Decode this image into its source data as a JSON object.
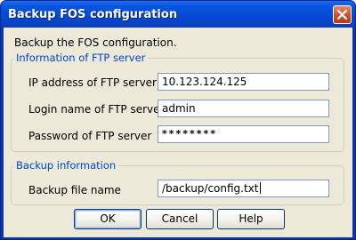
{
  "window": {
    "title": "Backup FOS configuration"
  },
  "dialog": {
    "description": "Backup the FOS configuration.",
    "ftp_group": {
      "title": "Information of FTP server",
      "ip_label": "IP address of FTP server",
      "ip_value": "10.123.124.125",
      "login_label": "Login name of FTP server",
      "login_value": "admin",
      "password_label": "Password of FTP server",
      "password_mask": "********"
    },
    "backup_group": {
      "title": "Backup information",
      "file_label": "Backup file name",
      "file_value": "/backup/config.txt"
    },
    "buttons": {
      "ok": "OK",
      "cancel": "Cancel",
      "help": "Help"
    }
  },
  "icons": {
    "close": "close-icon"
  },
  "colors": {
    "titlebar": "#0856de",
    "client": "#ece9d8",
    "group_title": "#0046d5",
    "close_button": "#c94a2a"
  }
}
